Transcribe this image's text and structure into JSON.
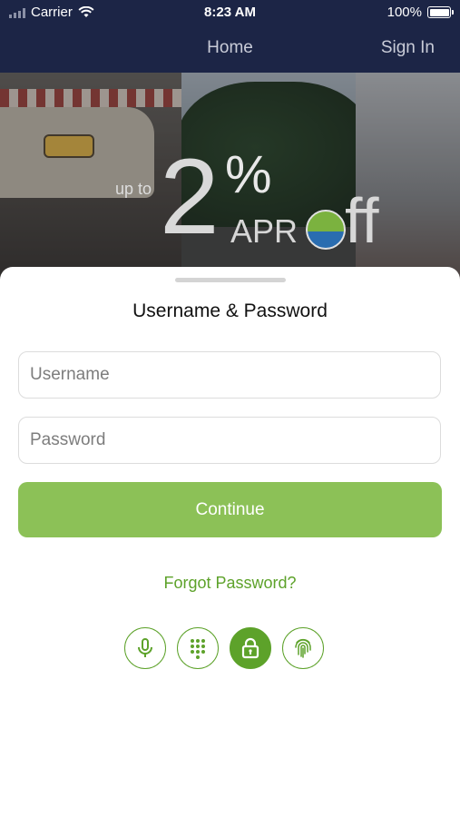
{
  "status_bar": {
    "carrier": "Carrier",
    "time": "8:23 AM",
    "battery": "100%"
  },
  "nav": {
    "title": "Home",
    "sign_in": "Sign In"
  },
  "banner": {
    "up_to": "up to",
    "big_number": "2",
    "percent": "%",
    "apr": "APR",
    "off_suffix": "ff"
  },
  "login": {
    "title": "Username & Password",
    "username_placeholder": "Username",
    "password_placeholder": "Password",
    "continue_label": "Continue",
    "forgot_label": "Forgot Password?"
  },
  "auth_methods": [
    {
      "icon": "microphone-icon",
      "active": false
    },
    {
      "icon": "keypad-icon",
      "active": false
    },
    {
      "icon": "lock-icon",
      "active": true
    },
    {
      "icon": "fingerprint-icon",
      "active": false
    }
  ],
  "colors": {
    "header_bg": "#1c2546",
    "accent": "#5da22a",
    "button_bg": "#8cc157"
  }
}
